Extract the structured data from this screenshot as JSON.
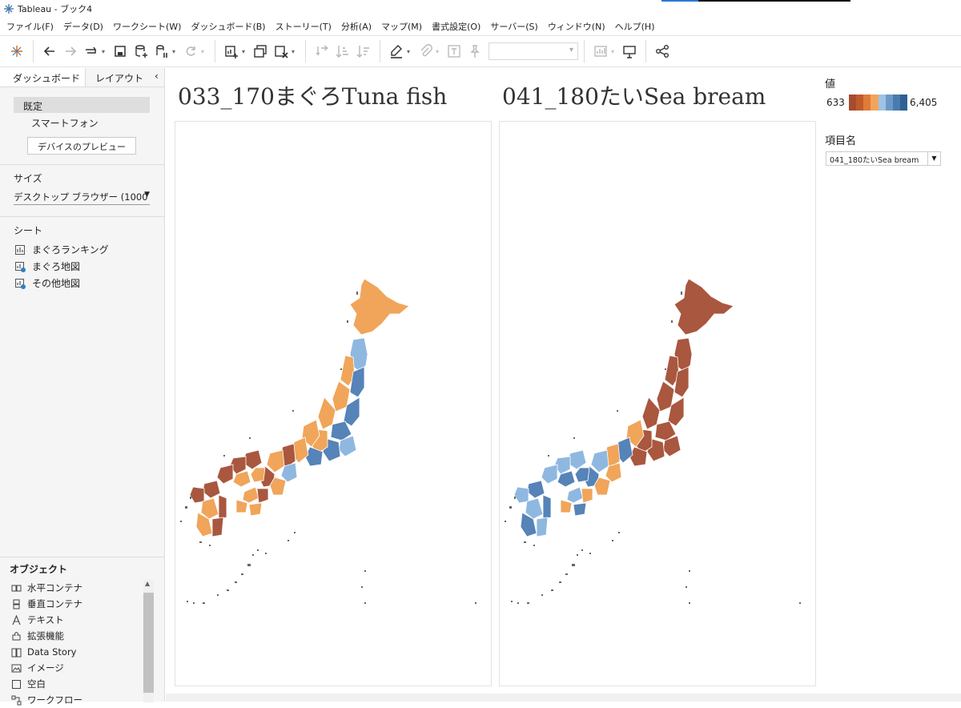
{
  "window": {
    "title": "Tableau - ブック4",
    "app_icon": "tableau-logo-icon",
    "accent_color": "#2b79d3"
  },
  "menu": [
    "ファイル(F)",
    "データ(D)",
    "ワークシート(W)",
    "ダッシュボード(B)",
    "ストーリー(T)",
    "分析(A)",
    "マップ(M)",
    "書式設定(O)",
    "サーバー(S)",
    "ウィンドウ(N)",
    "ヘルプ(H)"
  ],
  "toolbar": {
    "icons": [
      "tableau-logo-icon",
      "undo-icon",
      "redo-icon",
      "replay-icon",
      "save-icon",
      "new-datasource-icon",
      "pause-updates-icon",
      "refresh-icon",
      "new-worksheet-icon",
      "duplicate-sheet-icon",
      "clear-sheet-icon",
      "swap-icon",
      "sort-ascending-icon",
      "sort-descending-icon",
      "highlight-icon",
      "paperclip-icon",
      "text-label-icon",
      "pin-icon",
      "show-me-icon",
      "presentation-icon",
      "share-icon"
    ],
    "fit_value": ""
  },
  "left_panel": {
    "tabs": {
      "dashboard": "ダッシュボード",
      "layout": "レイアウト"
    },
    "devices": {
      "default": "既定",
      "phone": "スマートフォン",
      "preview_button": "デバイスのプレビュー"
    },
    "size": {
      "heading": "サイズ",
      "value": "デスクトップ ブラウザー (1000 …"
    },
    "sheets": {
      "heading": "シート",
      "items": [
        "まぐろランキング",
        "まぐろ地図",
        "その他地図"
      ]
    },
    "objects": {
      "heading": "オブジェクト",
      "items": [
        "水平コンテナ",
        "垂直コンテナ",
        "テキスト",
        "拡張機能",
        "Data Story",
        "イメージ",
        "空白",
        "ワークフロー"
      ]
    }
  },
  "dashboard": {
    "left_title": "033_170まぐろTuna fish",
    "right_title": "041_180たいSea bream",
    "legend": {
      "title": "値",
      "min": "633",
      "max": "6,405",
      "colors": [
        "#a74b2e",
        "#c05a2d",
        "#e07a3a",
        "#f2a55a",
        "#9ec3e6",
        "#6c9ac8",
        "#4a7bb0",
        "#2f5f93"
      ]
    },
    "filter": {
      "title": "項目名",
      "value": "041_180たいSea bream"
    },
    "map_colors": {
      "brown": "#a9573f",
      "orange": "#f0a55a",
      "lightblue": "#8fb8e0",
      "blue": "#5683b8",
      "island": "#666666"
    }
  }
}
